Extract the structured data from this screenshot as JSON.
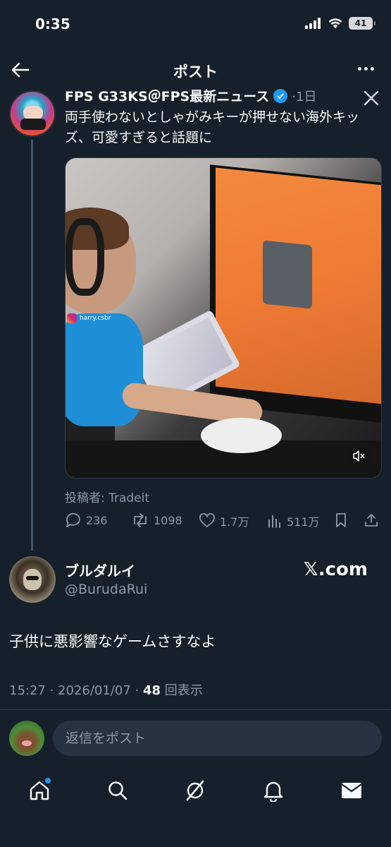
{
  "status_bar": {
    "time": "0:35",
    "battery": "41",
    "icons": [
      "signal-icon",
      "wifi-icon",
      "battery-icon"
    ]
  },
  "header": {
    "title": "ポスト",
    "back_icon": "back-arrow-icon",
    "more_icon": "more-icon"
  },
  "quoted_post": {
    "author_name": "FPS G33KS＠FPS最新ニュース",
    "time": "·1日",
    "text": "両手使わないとしゃがみキーが押せない海外キッズ、可愛すぎると話題に",
    "media_watermark": "harry.csbr",
    "attribution": "投稿者: Tradeit",
    "actions": {
      "replies": "236",
      "reposts": "1098",
      "likes": "1.7万",
      "views": "511万"
    }
  },
  "post": {
    "display_name": "ブルダルイ",
    "handle": "@BurudaRui",
    "badge": "𝕏.com",
    "text": "子供に悪影響なゲームさすなよ",
    "timestamp": "15:27 · 2026/01/07 · ",
    "view_count": "48",
    "view_label": " 回表示"
  },
  "reply": {
    "placeholder": "返信をポスト"
  },
  "bottom_nav": [
    "home-icon",
    "search-icon",
    "grok-icon",
    "bell-icon",
    "mail-icon"
  ],
  "colors": {
    "background": "#15202b",
    "accent": "#1d9bf0",
    "secondary_text": "#8b98a5"
  }
}
